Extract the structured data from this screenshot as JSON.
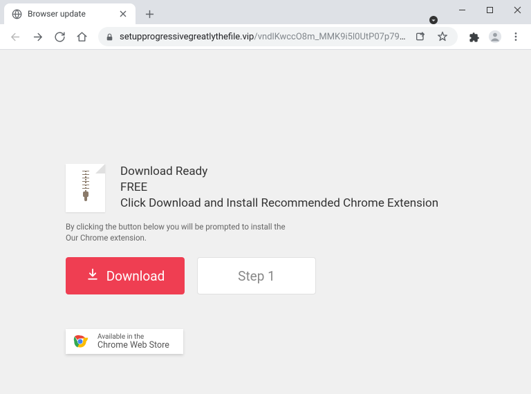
{
  "tab": {
    "title": "Browser update"
  },
  "omnibox": {
    "domain": "setupprogressivegreatlythefile.vip",
    "path": "/vndlKwccO8m_MMK9i5l0UtP07p79EuN7dxh9cIVc_00..."
  },
  "page": {
    "heading1": "Download Ready",
    "heading2": "FREE",
    "heading3": "Click Download and Install Recommended Chrome Extension",
    "disclaimer1": "By clicking the button below you will be prompted to install the",
    "disclaimer2": "Our Chrome extension.",
    "download_label": "Download",
    "step_label": "Step 1",
    "store_small": "Available in the",
    "store_big": "Chrome Web Store"
  }
}
